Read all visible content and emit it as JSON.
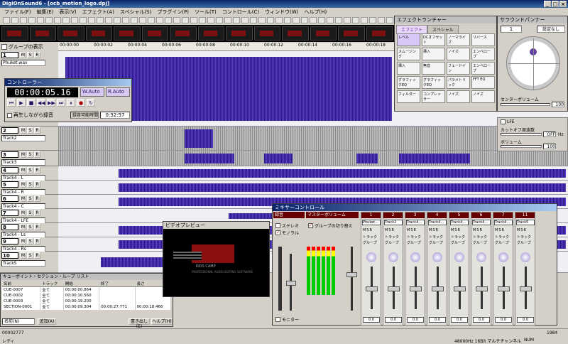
{
  "window": {
    "title": "DigiOnSound6 - [ocb_motion_logo.dpj]",
    "min": "_",
    "max": "□",
    "close": "×"
  },
  "menu": [
    "ファイル(F)",
    "編集(E)",
    "表示(V)",
    "エフェクト(A)",
    "スペシャル(S)",
    "プラグイン(P)",
    "ツール(T)",
    "コントロール(C)",
    "ウィンドウ(W)",
    "ヘルプ(H)"
  ],
  "header": {
    "group_toggle": "グループの表示"
  },
  "ruler_ticks": [
    "00:00:00",
    "00:00:02",
    "00:00:04",
    "00:00:06",
    "00:00:08",
    "00:00:10",
    "00:00:12",
    "00:00:14",
    "00:00:16",
    "00:00:18"
  ],
  "tracks": [
    {
      "num": "1",
      "name": "Phuket.wav"
    },
    {
      "num": "2",
      "name": "Track2"
    },
    {
      "num": "3",
      "name": "Track3"
    },
    {
      "num": "4",
      "name": "Track4 - L"
    },
    {
      "num": "5",
      "name": "Track4 - R"
    },
    {
      "num": "6",
      "name": "Track4 - C"
    },
    {
      "num": "7",
      "name": "Track4 - LFE"
    },
    {
      "num": "8",
      "name": "Track4 - Ls"
    },
    {
      "num": "9",
      "name": "Track4 - Rs"
    },
    {
      "num": "10",
      "name": "Track5"
    }
  ],
  "track_btn_labels": {
    "m": "M",
    "s": "S",
    "r": "R"
  },
  "controller": {
    "title": "コントローラー",
    "time": "00:00:05.16",
    "w_auto": "W.Auto",
    "r_auto": "R.Auto",
    "record_while_play": "再生しながら録音",
    "record_time_label": "録音可能時間",
    "record_time": "0:32:57"
  },
  "effects": {
    "title": "エフェクトランチャー",
    "tabs": [
      "エフェクト",
      "スペシャル"
    ],
    "items": [
      "レベル",
      "DCオフセット",
      "ノーマライズ",
      "リバース",
      "スムージング",
      "挿入",
      "ノイズ",
      "エンベロープ",
      "挿入",
      "無音",
      "フェードイン",
      "エンベロープ",
      "グラフィックEQ",
      "グラフィックEQ",
      "パラメトリック",
      "FFT EQ",
      "フィルター",
      "コンプレッサー",
      "ノイズ",
      "ノイズ"
    ]
  },
  "surround": {
    "title": "サラウンドパンナー",
    "channel": "1",
    "preset": "設定なし",
    "center_vol_label": "センターボリューム",
    "center_vol": "100",
    "lfe_label": "LFE",
    "cutoff_label": "カットオフ周波数",
    "cutoff": "OFF",
    "cutoff_unit": "Hz",
    "volume_label": "ボリューム",
    "volume": "100"
  },
  "video": {
    "title": "ビデオプレビュー",
    "caption": "KIDS CAMP",
    "info": "PROFESSIONAL AUDIO EDITING SOFTWARE"
  },
  "mixer": {
    "title": "ミキサーコントロール",
    "rec_label": "録音",
    "master_label": "マスターボリューム",
    "stereo": "ステレオ",
    "monaural": "モノラル",
    "group_toggle": "グループの切り替え",
    "monitor": "モニター",
    "strip_names": [
      "Phuket...",
      "Track2",
      "Track4...",
      "Track4...",
      "Track4...",
      "Track4...",
      "Track4...",
      "Track5"
    ],
    "strip_nums": [
      "1",
      "2",
      "3",
      "4",
      "5",
      "6",
      "7",
      "11"
    ],
    "strip_value": "0.0",
    "group_label": "グループ",
    "track_label": "トラック"
  },
  "cuelist": {
    "title": "キューポイント・セクション・ループ リスト",
    "headers": [
      "名前",
      "トラック",
      "開始",
      "終了",
      "長さ"
    ],
    "rows": [
      [
        "CUE-0007",
        "全て",
        "00:00:00.864",
        "",
        ""
      ],
      [
        "CUE-0002",
        "全て",
        "00:00:10.560",
        "",
        ""
      ],
      [
        "CUE-0003",
        "全て",
        "00:00:19.200",
        "",
        ""
      ],
      [
        "SECTION-0001",
        "全て",
        "00:00:09.304",
        "00:00:27.771",
        "00:00:18.466"
      ]
    ],
    "filter_value": "名前(N)",
    "add_button": "追加(A)",
    "write_button": "書き出し(E)",
    "help_button": "ヘルプ(H)"
  },
  "status": {
    "position": "00002777",
    "ready": "レディ",
    "format": "48000Hz 16Bit マルチチャンネル",
    "caps": "NUM",
    "size": "1984"
  }
}
